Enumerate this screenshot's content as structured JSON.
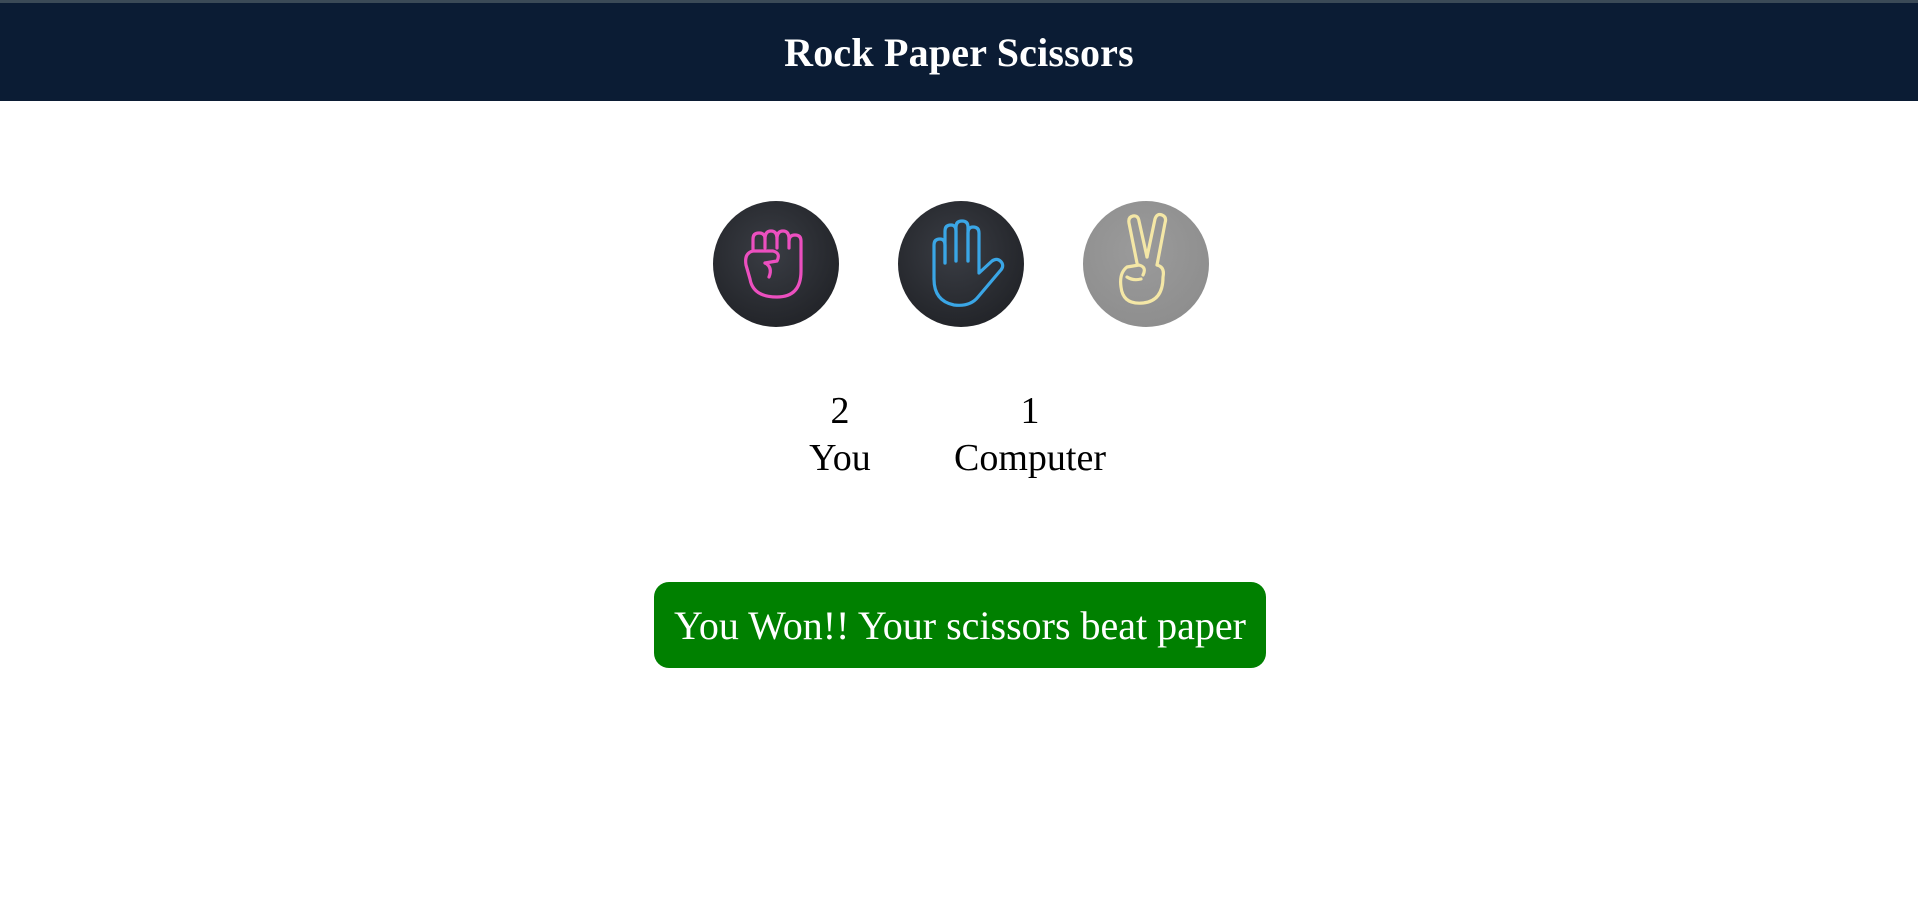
{
  "header": {
    "title": "Rock Paper Scissors"
  },
  "choices": [
    {
      "name": "rock",
      "icon": "rock-fist-icon",
      "color": "#ec4fbf"
    },
    {
      "name": "paper",
      "icon": "paper-hand-icon",
      "color": "#3aa6e6"
    },
    {
      "name": "scissors",
      "icon": "scissors-hand-icon",
      "color": "#f4e7a6"
    }
  ],
  "scores": {
    "user": {
      "value": "2",
      "label": "You"
    },
    "computer": {
      "value": "1",
      "label": "Computer"
    }
  },
  "result": {
    "message": "You Won!! Your scissors beat paper",
    "color": "#008000"
  },
  "colors": {
    "header_bg": "#0b1c34",
    "result_bg": "#008000"
  }
}
